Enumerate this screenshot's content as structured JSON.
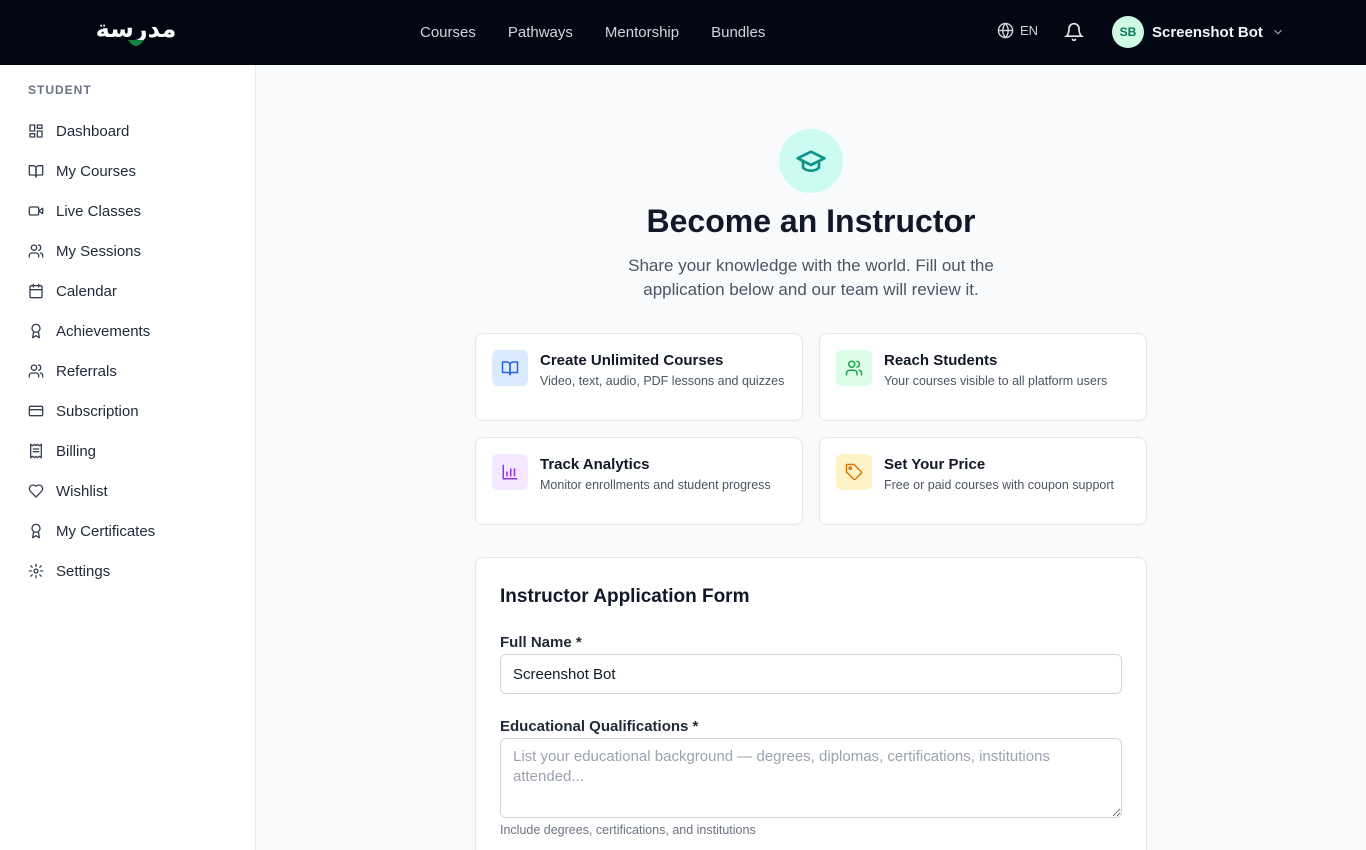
{
  "brand": {
    "logo_text": "مدرسة"
  },
  "nav": {
    "links": [
      "Courses",
      "Pathways",
      "Mentorship",
      "Bundles"
    ]
  },
  "header": {
    "language": "EN",
    "avatar_initials": "SB",
    "user_name": "Screenshot Bot"
  },
  "sidebar": {
    "section": "STUDENT",
    "items": [
      {
        "label": "Dashboard",
        "icon": "dashboard-icon"
      },
      {
        "label": "My Courses",
        "icon": "book-open-icon"
      },
      {
        "label": "Live Classes",
        "icon": "video-icon"
      },
      {
        "label": "My Sessions",
        "icon": "users-icon"
      },
      {
        "label": "Calendar",
        "icon": "calendar-icon"
      },
      {
        "label": "Achievements",
        "icon": "award-icon"
      },
      {
        "label": "Referrals",
        "icon": "users-icon"
      },
      {
        "label": "Subscription",
        "icon": "credit-card-icon"
      },
      {
        "label": "Billing",
        "icon": "receipt-icon"
      },
      {
        "label": "Wishlist",
        "icon": "heart-icon"
      },
      {
        "label": "My Certificates",
        "icon": "award-icon"
      },
      {
        "label": "Settings",
        "icon": "gear-icon"
      }
    ]
  },
  "hero": {
    "title": "Become an Instructor",
    "subtitle": "Share your knowledge with the world. Fill out the application below and our team will review it."
  },
  "features": [
    {
      "title": "Create Unlimited Courses",
      "desc": "Video, text, audio, PDF lessons and quizzes",
      "icon": "book-open-icon",
      "color": "#2563eb",
      "bg": "#dbeafe"
    },
    {
      "title": "Reach Students",
      "desc": "Your courses visible to all platform users",
      "icon": "users-icon",
      "color": "#16a34a",
      "bg": "#dcfce7"
    },
    {
      "title": "Track Analytics",
      "desc": "Monitor enrollments and student progress",
      "icon": "bar-chart-icon",
      "color": "#9333ea",
      "bg": "#f3e8ff"
    },
    {
      "title": "Set Your Price",
      "desc": "Free or paid courses with coupon support",
      "icon": "tag-icon",
      "color": "#d97706",
      "bg": "#fef3c7"
    }
  ],
  "form": {
    "title": "Instructor Application Form",
    "full_name_label": "Full Name *",
    "full_name_value": "Screenshot Bot",
    "qualifications_label": "Educational Qualifications *",
    "qualifications_placeholder": "List your educational background — degrees, diplomas, certifications, institutions attended...",
    "qualifications_hint": "Include degrees, certifications, and institutions"
  },
  "colors": {
    "nav_bg": "#030712",
    "accent": "#0d9488"
  }
}
